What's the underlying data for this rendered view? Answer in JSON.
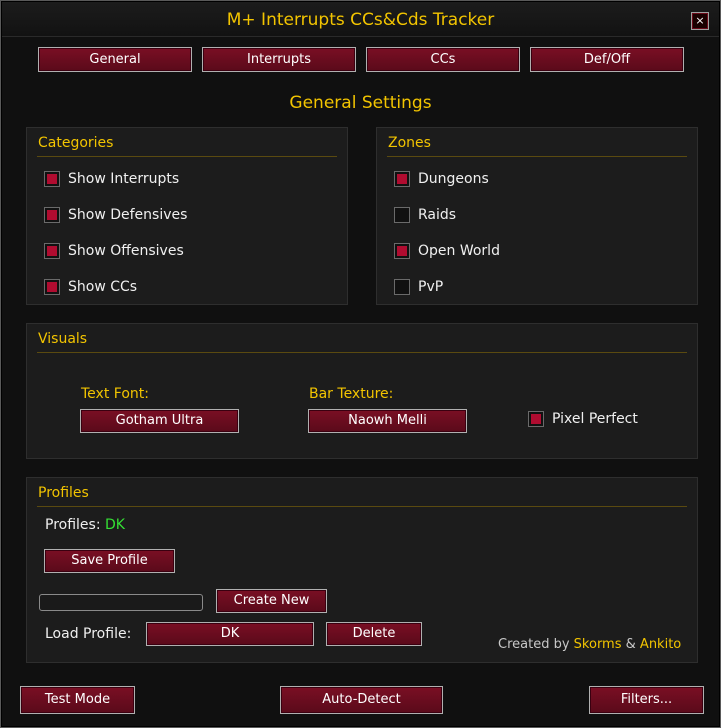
{
  "window": {
    "title": "M+ Interrupts CCs&Cds Tracker",
    "close_label": "×"
  },
  "tabs": [
    "General",
    "Interrupts",
    "CCs",
    "Def/Off"
  ],
  "heading": "General Settings",
  "categories": {
    "title": "Categories",
    "items": [
      {
        "label": "Show Interrupts",
        "checked": true
      },
      {
        "label": "Show Defensives",
        "checked": true
      },
      {
        "label": "Show Offensives",
        "checked": true
      },
      {
        "label": "Show CCs",
        "checked": true
      }
    ]
  },
  "zones": {
    "title": "Zones",
    "items": [
      {
        "label": "Dungeons",
        "checked": true
      },
      {
        "label": "Raids",
        "checked": false
      },
      {
        "label": "Open World",
        "checked": true
      },
      {
        "label": "PvP",
        "checked": false
      }
    ]
  },
  "visuals": {
    "title": "Visuals",
    "text_font_label": "Text Font:",
    "text_font_value": "Gotham Ultra",
    "bar_texture_label": "Bar Texture:",
    "bar_texture_value": "Naowh Melli",
    "pixel_perfect": {
      "label": "Pixel Perfect",
      "checked": true
    }
  },
  "profiles": {
    "title": "Profiles",
    "profiles_label": "Profiles:",
    "current_profile": "DK",
    "save_label": "Save Profile",
    "new_name_value": "",
    "create_label": "Create New",
    "load_label": "Load Profile:",
    "load_value": "DK",
    "delete_label": "Delete",
    "credit_prefix": "Created by",
    "credit_author1": "Skorms",
    "credit_amp": "&",
    "credit_author2": "Ankito"
  },
  "footer": {
    "test_mode": "Test Mode",
    "auto_detect": "Auto-Detect",
    "filters": "Filters..."
  },
  "colors": {
    "accent_gold": "#f2c400",
    "button_red": "#7a0f24",
    "checkbox_red": "#b00c30",
    "profile_green": "#34e034"
  }
}
